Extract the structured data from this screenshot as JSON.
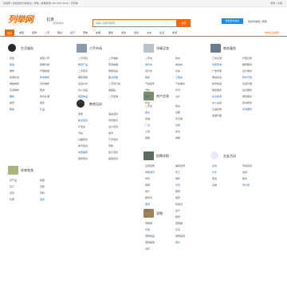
{
  "topbar": {
    "left": "百姓网 | 免费发布分类信息 | 帮助 | 客服热线 400-000-0000 | 手机版",
    "right": "登录 | 注册"
  },
  "header": {
    "logo": "列举网",
    "city": "北京",
    "city_sub": "[切换城市]",
    "search_placeholder": "请输入关键词搜索...",
    "search_button": "搜索",
    "publish_button": "免费发布信息",
    "guest_link": "我的列举网 | 帮助"
  },
  "nav": {
    "items": [
      "首页",
      "求职",
      "招聘",
      "二手",
      "租房",
      "房产",
      "宠物",
      "车辆",
      "服务",
      "商务",
      "培训",
      "交友",
      "生活",
      "旅游"
    ],
    "active_index": 0,
    "right": "城市生活指南"
  },
  "colors": {
    "accent": "#ff6600",
    "publish": "#1e88e5",
    "link": "#2b6cb0"
  },
  "categories": [
    {
      "title": "生活服务",
      "items": [
        "家政",
        "搬家公司",
        "保洁",
        "保姆月嫂",
        "维修",
        "开锁换锁",
        "疏通管道",
        "家电维修",
        "电脑维修",
        "手机维修",
        "空调维修",
        "装修",
        "翻新",
        "防水补漏",
        "婚庆",
        "摄影",
        "租车",
        "礼品"
      ]
    },
    {
      "title": "商务服务",
      "items": [
        "工商注册",
        "代理记账",
        "法律咨询",
        "翻译服务",
        "广告印刷",
        "设计策划",
        "网站建设",
        "软件开发",
        "物流快递",
        "货运代理",
        "展会服务",
        "会议服务",
        "投资担保",
        "保险服务",
        "办公设备",
        "建材装修",
        "五金机电",
        "清洗服务",
        "加盟代理"
      ]
    },
    {
      "title": "教育培训",
      "items": [
        "家教",
        "语言培训",
        "职业培训",
        "学历教育",
        "IT培训",
        "设计培训",
        "驾校",
        "留学",
        "兴趣培训",
        "艺术培训",
        "体育培训",
        "早教",
        "考研辅导",
        "会计培训",
        "厨师培训",
        "美容培训"
      ]
    },
    {
      "title": "二手市场",
      "items": [
        "二手手机",
        "二手电脑",
        "数码产品",
        "家用电器",
        "二手家具",
        "母婴用品",
        "服装鞋帽",
        "图书音像",
        "运动户外",
        "二手自行车",
        "办公用品",
        "收藏品",
        "闲置物品",
        "二手回收",
        "求购"
      ]
    },
    {
      "title": "房产信息",
      "items": [
        "二手房",
        "新房",
        "租房",
        "合租",
        "商铺",
        "写字楼",
        "厂房",
        "仓库",
        "土地",
        "车位",
        "短租",
        "求租"
      ]
    },
    {
      "title": "车辆买卖",
      "items": [
        "二手车",
        "新车",
        "摩托车",
        "电动车",
        "自行车",
        "货车",
        "客车",
        "工程车",
        "汽车配件",
        "汽车服务",
        "驾校",
        "代驾",
        "租车",
        "过户",
        "年检"
      ]
    },
    {
      "title": "宠物",
      "items": [
        "宠物狗",
        "宠物猫",
        "水族",
        "花鸟",
        "宠物用品",
        "宠物医院",
        "宠物美容",
        "寄养",
        "领养"
      ]
    },
    {
      "title": "招聘求职",
      "items": [
        "全职招聘",
        "兼职招聘",
        "求职简历",
        "普工",
        "司机",
        "销售",
        "客服",
        "文员",
        "会计",
        "厨师",
        "服务员",
        "保安",
        "保洁",
        "快递员",
        "技工",
        "设计",
        "IT",
        "教师"
      ]
    },
    {
      "title": "交友活动",
      "items": [
        "交友",
        "同城活动",
        "户外",
        "运动",
        "聚会",
        "相亲",
        "征婚",
        "老乡会"
      ]
    },
    {
      "title": "农林牧渔",
      "items": [
        "农产品",
        "种苗",
        "花卉",
        "养殖",
        "农机",
        "饲料",
        "化肥",
        "渔具"
      ]
    }
  ]
}
